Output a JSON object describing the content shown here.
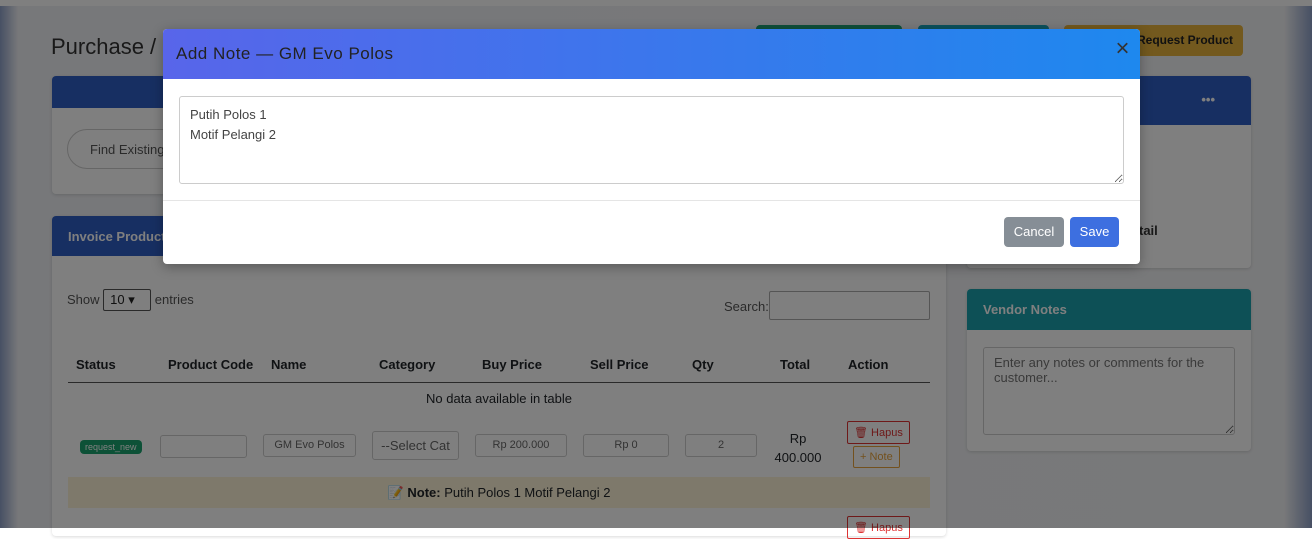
{
  "page": {
    "title": "Purchase / ",
    "request_product": "Request Product",
    "find_existing": "Find Existing",
    "more": "•••",
    "detail_fragment": "tail"
  },
  "invoice": {
    "header": "Invoice Products",
    "show": "Show",
    "entries": "entries",
    "entries_value": "10",
    "search_label": "Search:",
    "columns": [
      "Status",
      "Product Code",
      "Name",
      "Category",
      "Buy Price",
      "Sell Price",
      "Qty",
      "Total",
      "Action"
    ],
    "empty": "No data available in table",
    "row": {
      "status": "request_new",
      "code": "",
      "name": "GM Evo Polos",
      "category": "--Select Cat",
      "buy": "Rp 200.000",
      "sell": "Rp 0",
      "qty": "2",
      "total_1": "Rp",
      "total_2": "400.000",
      "delete": "Hapus",
      "note": "+ Note"
    },
    "note_label": "Note:",
    "note_text": "Putih Polos 1 Motif Pelangi 2",
    "delete2": "Hapus"
  },
  "vendor": {
    "header": "Vendor Notes",
    "placeholder": "Enter any notes or comments for the customer..."
  },
  "modal": {
    "title": "Add Note — GM Evo Polos",
    "close": "×",
    "note_value": "Putih Polos 1\nMotif Pelangi 2",
    "cancel": "Cancel",
    "save": "Save"
  },
  "colors": {
    "modal_header_start": "#5865ea",
    "modal_header_end": "#1e88ee",
    "save": "#3d6fe0",
    "cancel": "#868e96",
    "badge": "#1aa36f",
    "warning": "#e7b23c"
  }
}
